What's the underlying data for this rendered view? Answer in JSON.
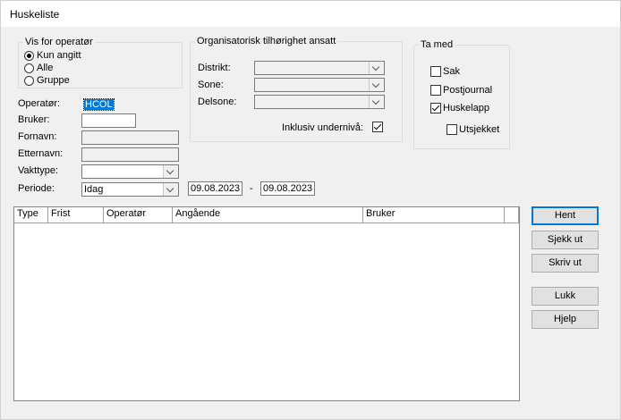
{
  "window": {
    "title": "Huskeliste"
  },
  "vis_for": {
    "legend": "Vis for operatør",
    "options": [
      "Kun angitt",
      "Alle",
      "Gruppe"
    ],
    "selected": "Kun angitt"
  },
  "org": {
    "legend": "Organisatorisk tilhørighet ansatt",
    "distrikt_label": "Distrikt:",
    "sone_label": "Sone:",
    "delsone_label": "Delsone:",
    "inklusiv_label": "Inklusiv undernivå:",
    "inklusiv_checked": true
  },
  "ta_med": {
    "legend": "Ta med",
    "sak": "Sak",
    "postjournal": "Postjournal",
    "huskelapp": "Huskelapp",
    "utsjekket": "Utsjekket",
    "sak_checked": false,
    "postjournal_checked": false,
    "huskelapp_checked": true,
    "utsjekket_checked": false
  },
  "form": {
    "operator_label": "Operatør:",
    "operator_value": "HCOL",
    "bruker_label": "Bruker:",
    "fornavn_label": "Fornavn:",
    "etternavn_label": "Etternavn:",
    "vakttype_label": "Vakttype:",
    "periode_label": "Periode:",
    "periode_value": "Idag",
    "date_from": "09.08.2023",
    "date_sep": "-",
    "date_to": "09.08.2023"
  },
  "grid": {
    "columns": [
      "Type",
      "Frist",
      "Operatør",
      "Angående",
      "Bruker"
    ]
  },
  "buttons": {
    "hent": "Hent",
    "sjekk_ut": "Sjekk ut",
    "skriv_ut": "Skriv ut",
    "lukk": "Lukk",
    "hjelp": "Hjelp"
  }
}
